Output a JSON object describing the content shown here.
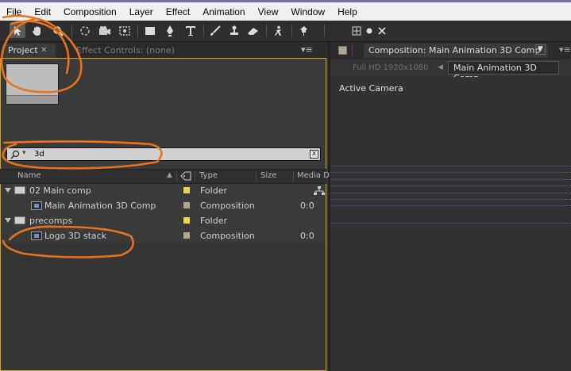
{
  "menu": [
    "File",
    "Edit",
    "Composition",
    "Layer",
    "Effect",
    "Animation",
    "View",
    "Window",
    "Help"
  ],
  "tools": [
    "selection-tool",
    "hand-tool",
    "zoom-tool",
    "rotation-tool",
    "camera-tool",
    "pan-behind-tool",
    "rectangle-tool",
    "pen-tool",
    "type-tool",
    "brush-tool",
    "clone-stamp-tool",
    "eraser-tool",
    "roto-brush-tool",
    "puppet-pin-tool"
  ],
  "project_panel": {
    "tab_project": "Project",
    "tab_effect_controls": "Effect Controls: (none)",
    "search": {
      "value": "3d",
      "clear_label": "x"
    },
    "columns": {
      "name": "Name",
      "type": "Type",
      "size": "Size",
      "media": "Media D"
    },
    "items": [
      {
        "name": "02 Main comp",
        "type": "Folder",
        "media": "",
        "label_color": "#e8d84a",
        "kind": "folder"
      },
      {
        "name": "Main Animation 3D Comp",
        "type": "Composition",
        "media": "0:0",
        "label_color": "#b5a58a",
        "kind": "comp"
      },
      {
        "name": "precomps",
        "type": "Folder",
        "media": "",
        "label_color": "#e8d84a",
        "kind": "folder"
      },
      {
        "name": "Logo 3D stack",
        "type": "Composition",
        "media": "0:0",
        "label_color": "#b5a58a",
        "kind": "comp"
      }
    ]
  },
  "composition_panel": {
    "tab_label": "Composition: Main Animation 3D Comp",
    "resolution_label": "Full HD 1920x1080",
    "comp_button": "Main Animation 3D Comp",
    "active_camera": "Active Camera"
  },
  "colors": {
    "annotation": "#e8731c",
    "guide": "#5b60b8",
    "active_border": "#d8a31a"
  }
}
